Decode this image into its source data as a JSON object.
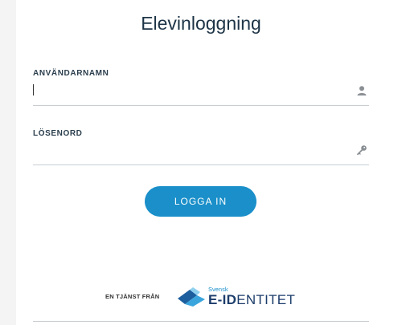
{
  "title": "Elevinloggning",
  "username": {
    "label": "ANVÄNDARNAMN",
    "value": "",
    "icon": "user-icon"
  },
  "password": {
    "label": "LÖSENORD",
    "value": "",
    "icon": "key-icon"
  },
  "login_button": "LOGGA IN",
  "footer": {
    "text": "EN TJÄNST FRÅN",
    "logo_small": "Svensk",
    "logo_bold": "E-ID",
    "logo_rest": "ENTITET"
  },
  "colors": {
    "accent": "#1a8fc9",
    "title": "#1d3446",
    "logo_dark": "#1d3d6b"
  }
}
